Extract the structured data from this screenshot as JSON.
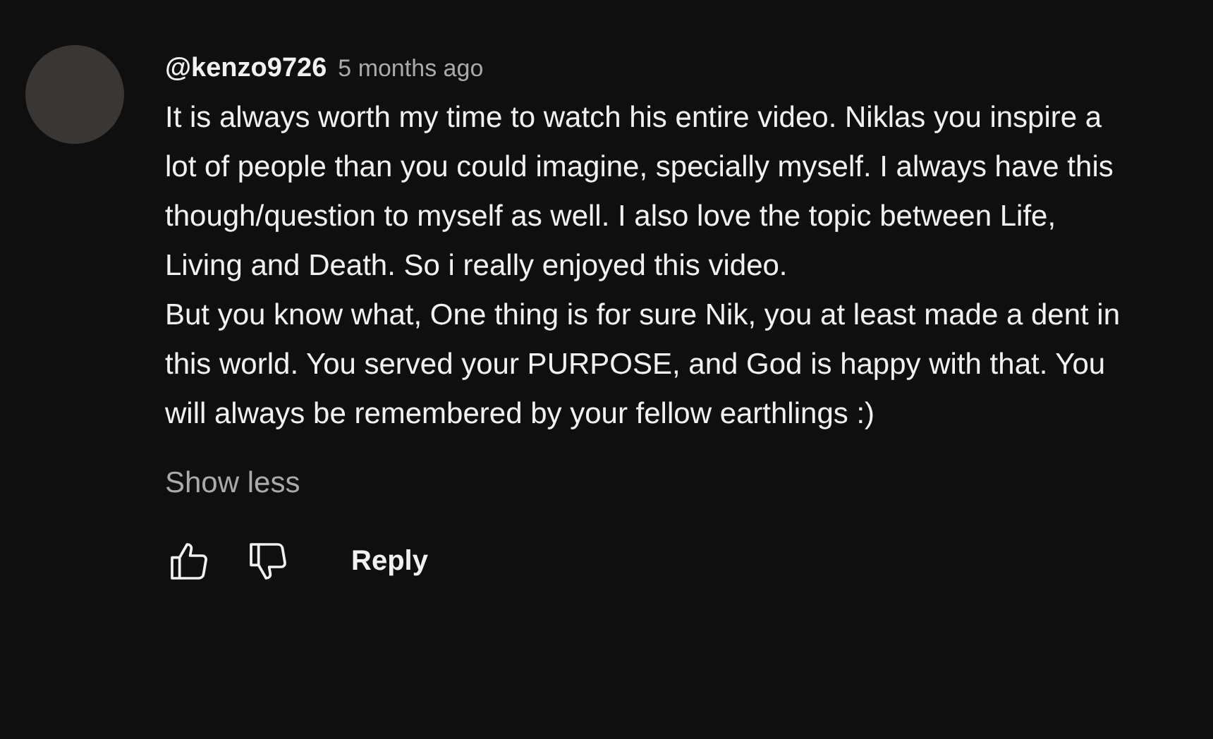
{
  "comment": {
    "author": "@kenzo9726",
    "time": "5 months ago",
    "paragraphs": [
      "It is always worth my time to watch his entire video. Niklas you inspire a lot of people than you could imagine, specially myself. I always have this though/question to myself as well. I also love the topic between Life, Living and Death. So i really enjoyed this video.",
      "But you know what, One thing is for sure Nik, you at least made a dent in this world. You served your PURPOSE, and God is happy with that. You will always be remembered by your fellow earthlings :)"
    ],
    "toggle": "Show less",
    "reply": "Reply"
  }
}
